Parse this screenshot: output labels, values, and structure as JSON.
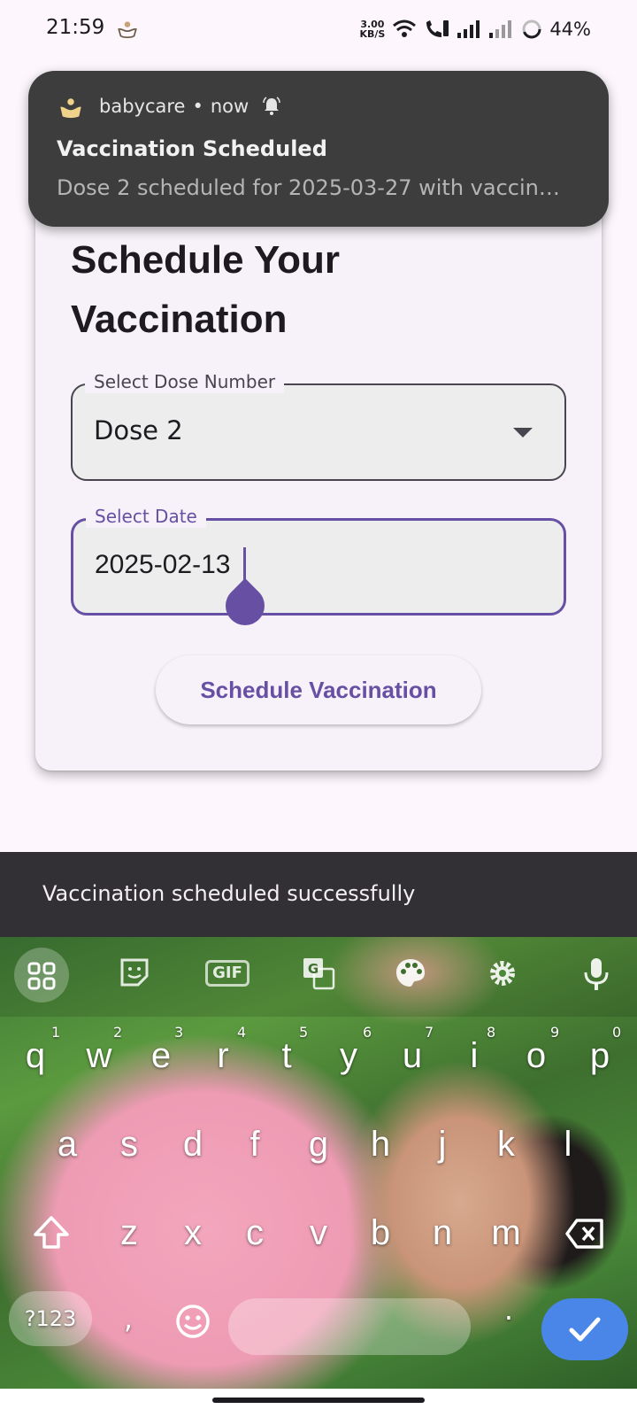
{
  "status_bar": {
    "time": "21:59",
    "net_speed_value": "3.00",
    "net_speed_unit": "KB/S",
    "battery": "44%"
  },
  "notification": {
    "app_name": "babycare",
    "when": "now",
    "separator": "•",
    "title": "Vaccination Scheduled",
    "body": "Dose 2 scheduled for 2025-03-27 with vaccin…"
  },
  "form": {
    "title": "Schedule Your Vaccination",
    "dose": {
      "label": "Select Dose Number",
      "value": "Dose 2"
    },
    "date": {
      "label": "Select Date",
      "value": "2025-02-13"
    },
    "submit_label": "Schedule Vaccination"
  },
  "snackbar": {
    "message": "Vaccination scheduled successfully"
  },
  "keyboard": {
    "toolbar": [
      "grid-icon",
      "sticker-icon",
      "GIF",
      "translate-icon",
      "palette-icon",
      "settings-icon",
      "mic-icon"
    ],
    "gif_label": "GIF",
    "row1": [
      "q",
      "w",
      "e",
      "r",
      "t",
      "y",
      "u",
      "i",
      "o",
      "p"
    ],
    "row1_hints": [
      "1",
      "2",
      "3",
      "4",
      "5",
      "6",
      "7",
      "8",
      "9",
      "0"
    ],
    "row2": [
      "a",
      "s",
      "d",
      "f",
      "g",
      "h",
      "j",
      "k",
      "l"
    ],
    "row3": [
      "z",
      "x",
      "c",
      "v",
      "b",
      "n",
      "m"
    ],
    "numbers_label": "?123",
    "comma": ",",
    "period": "."
  },
  "colors": {
    "accent": "#6750a4",
    "snackbar": "#322f35",
    "notification": "#3d3d3d",
    "enter_key": "#4a86e8"
  }
}
